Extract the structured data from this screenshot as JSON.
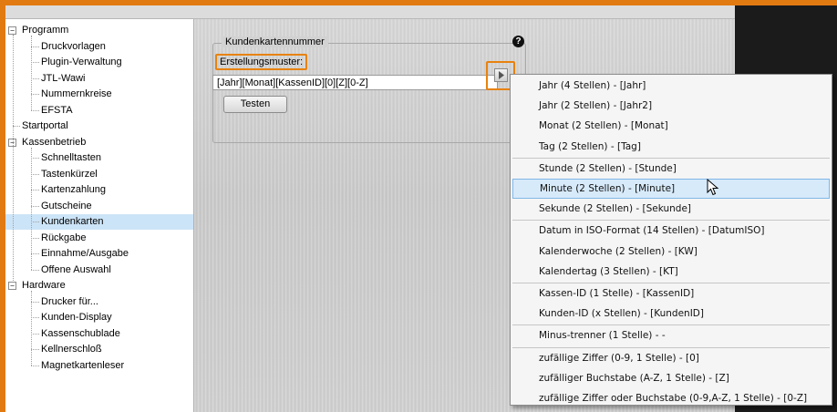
{
  "tree": {
    "items": [
      {
        "label": "Programm",
        "level": 0,
        "expander": "−"
      },
      {
        "label": "Druckvorlagen",
        "level": 1
      },
      {
        "label": "Plugin-Verwaltung",
        "level": 1
      },
      {
        "label": "JTL-Wawi",
        "level": 1
      },
      {
        "label": "Nummernkreise",
        "level": 1
      },
      {
        "label": "EFSTA",
        "level": 1
      },
      {
        "label": "Startportal",
        "level": 0
      },
      {
        "label": "Kassenbetrieb",
        "level": 0,
        "expander": "−"
      },
      {
        "label": "Schnelltasten",
        "level": 1
      },
      {
        "label": "Tastenkürzel",
        "level": 1
      },
      {
        "label": "Kartenzahlung",
        "level": 1
      },
      {
        "label": "Gutscheine",
        "level": 1
      },
      {
        "label": "Kundenkarten",
        "level": 1,
        "selected": true
      },
      {
        "label": "Rückgabe",
        "level": 1
      },
      {
        "label": "Einnahme/Ausgabe",
        "level": 1
      },
      {
        "label": "Offene Auswahl",
        "level": 1
      },
      {
        "label": "Hardware",
        "level": 0,
        "expander": "−"
      },
      {
        "label": "Drucker für...",
        "level": 1
      },
      {
        "label": "Kunden-Display",
        "level": 1
      },
      {
        "label": "Kassenschublade",
        "level": 1
      },
      {
        "label": "Kellnerschloß",
        "level": 1
      },
      {
        "label": "Magnetkartenleser",
        "level": 1
      }
    ]
  },
  "panel": {
    "group_title": "Kundenkartennummer",
    "help_icon": "?",
    "muster_label": "Erstellungsmuster:",
    "muster_value": "[Jahr][Monat][KassenID][0][Z][0-Z]",
    "test_button": "Testen"
  },
  "menu": {
    "groups": [
      [
        "Jahr (4 Stellen) - [Jahr]",
        "Jahr (2 Stellen) - [Jahr2]",
        "Monat (2 Stellen) - [Monat]",
        "Tag (2 Stellen) - [Tag]"
      ],
      [
        "Stunde (2 Stellen) - [Stunde]",
        "Minute (2 Stellen) - [Minute]",
        "Sekunde (2 Stellen) - [Sekunde]"
      ],
      [
        "Datum in ISO-Format (14 Stellen) - [DatumISO]",
        "Kalenderwoche (2 Stellen) - [KW]",
        "Kalendertag (3 Stellen) - [KT]"
      ],
      [
        "Kassen-ID (1 Stelle) - [KassenID]",
        "Kunden-ID (x Stellen) - [KundenID]"
      ],
      [
        "Minus-trenner (1 Stelle) - -"
      ],
      [
        "zufällige Ziffer (0-9, 1 Stelle) - [0]",
        "zufälliger Buchstabe (A-Z, 1 Stelle) - [Z]",
        "zufällige Ziffer oder Buchstabe (0-9,A-Z, 1 Stelle) - [0-Z]"
      ]
    ],
    "highlighted": "Minute (2 Stellen) - [Minute]"
  },
  "colors": {
    "accent": "#e8820e",
    "selection": "#cce4f7",
    "menu_highlight": "#d7eafa"
  }
}
